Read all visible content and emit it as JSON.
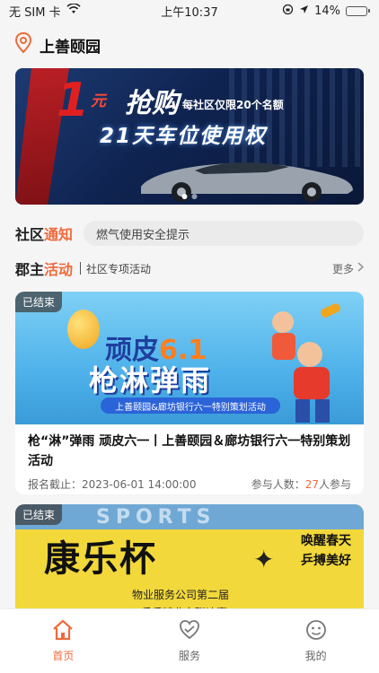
{
  "status_bar": {
    "carrier": "无 SIM 卡",
    "time": "上午10:37",
    "battery": "14%",
    "battery_level": 0.14,
    "battery_color": "#e53935"
  },
  "header": {
    "location": "上善颐园"
  },
  "banner": {
    "number": "1",
    "headline_small": "元",
    "headline": "抢购",
    "tag": "每社区仅限20个名额",
    "subline": "21天车位使用权",
    "slide_count": 2,
    "active_slide": 1
  },
  "notice": {
    "label_plain": "社区",
    "label_accent": "通知",
    "text": "燃气使用安全提示"
  },
  "section": {
    "title_plain": "郡主",
    "title_accent": "活动",
    "subtitle": "社区专项活动",
    "more": "更多"
  },
  "activities": [
    {
      "status": "已结束",
      "poster": {
        "line1_a": "顽皮",
        "line1_num": "6.1",
        "line2": "枪淋弹雨",
        "strip": "上善颐园&廊坊银行六一特别策划活动"
      },
      "title": "枪“淋”弹雨  顽皮六一丨上善颐园＆廊坊银行六一特别策划活动",
      "deadline": "报名截止：2023-06-01 14:00:00",
      "participants_label": "参与人数：",
      "participants_count": "27",
      "participants_suffix": "人参与"
    },
    {
      "status": "已结束",
      "poster": {
        "banner": "SPORTS",
        "title": "康乐杯",
        "slogan1": "唤醒春天",
        "slogan2": "乒搏美好",
        "sub1": "物业服务公司第二届",
        "sub2": "乒乓球业主联谊赛"
      }
    }
  ],
  "tabs": [
    {
      "label": "首页",
      "icon": "home-icon",
      "active": true
    },
    {
      "label": "服务",
      "icon": "service-icon",
      "active": false
    },
    {
      "label": "我的",
      "icon": "profile-icon",
      "active": false
    }
  ],
  "colors": {
    "accent": "#f06a3c",
    "tab_inactive": "#666666"
  }
}
